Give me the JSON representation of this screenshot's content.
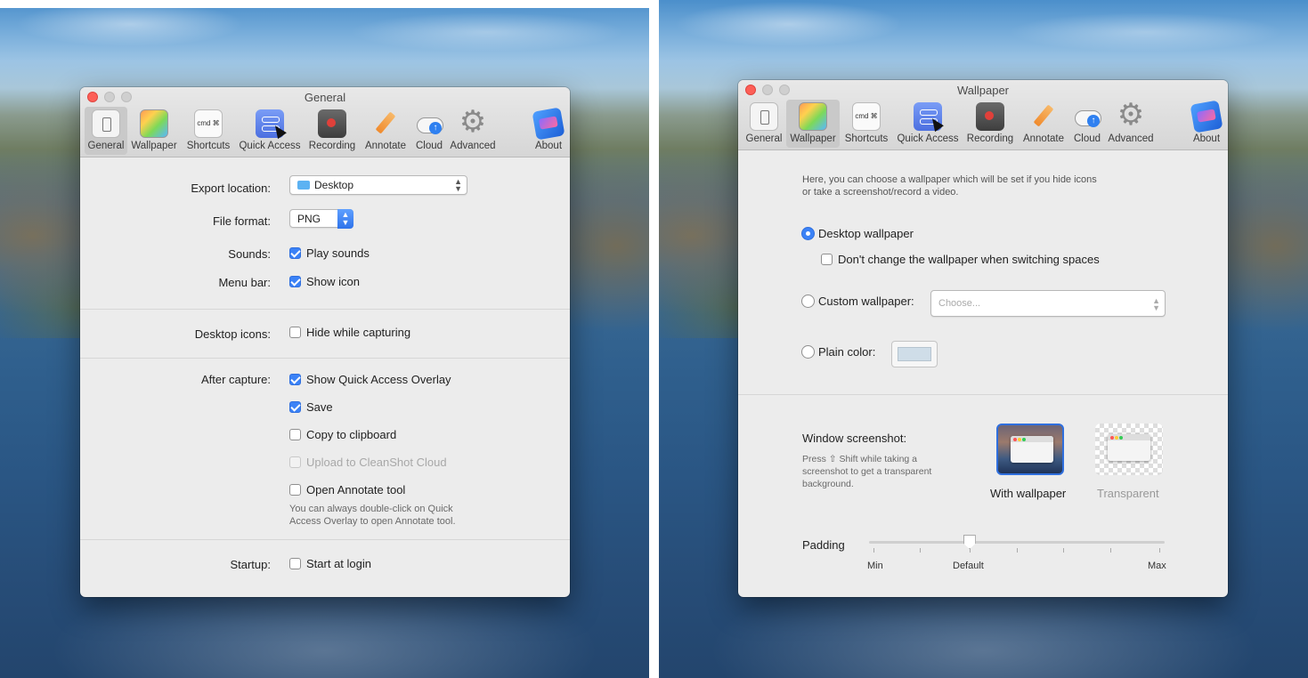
{
  "toolbar_items": [
    {
      "label": "General",
      "icon": "general-icon"
    },
    {
      "label": "Wallpaper",
      "icon": "wallpaper-icon"
    },
    {
      "label": "Shortcuts",
      "icon": "shortcuts-icon",
      "glyph": "cmd ⌘"
    },
    {
      "label": "Quick Access",
      "icon": "quick-access-icon"
    },
    {
      "label": "Recording",
      "icon": "recording-icon"
    },
    {
      "label": "Annotate",
      "icon": "annotate-icon"
    },
    {
      "label": "Cloud",
      "icon": "cloud-icon"
    },
    {
      "label": "Advanced",
      "icon": "advanced-icon"
    },
    {
      "label": "About",
      "icon": "about-icon"
    }
  ],
  "general": {
    "title": "General",
    "export_location_label": "Export location:",
    "export_location_value": "Desktop",
    "file_format_label": "File format:",
    "file_format_value": "PNG",
    "sounds_label": "Sounds:",
    "play_sounds": "Play sounds",
    "menu_bar_label": "Menu bar:",
    "show_icon": "Show icon",
    "desktop_icons_label": "Desktop icons:",
    "hide_while_capturing": "Hide while capturing",
    "after_capture_label": "After capture:",
    "show_quick_access_overlay": "Show Quick Access Overlay",
    "save": "Save",
    "copy_to_clipboard": "Copy to clipboard",
    "upload_to_cloud": "Upload to CleanShot Cloud",
    "open_annotate_tool": "Open Annotate tool",
    "annotate_hint_1": "You can always double-click on Quick",
    "annotate_hint_2": "Access Overlay to open Annotate tool.",
    "startup_label": "Startup:",
    "start_at_login": "Start at login"
  },
  "wallpaper": {
    "title": "Wallpaper",
    "intro_1": "Here, you can choose a wallpaper which will be set if you hide icons",
    "intro_2": "or take a screenshot/record a video.",
    "desktop_wallpaper": "Desktop wallpaper",
    "dont_change": "Don't change the wallpaper when switching spaces",
    "custom_wallpaper": "Custom wallpaper:",
    "choose_placeholder": "Choose...",
    "plain_color": "Plain color:",
    "plain_color_value": "#cfdde8",
    "window_screenshot_label": "Window screenshot:",
    "ws_hint_1": "Press ⇧ Shift while taking a",
    "ws_hint_2": "screenshot to get a transparent",
    "ws_hint_3": "background.",
    "with_wallpaper": "With wallpaper",
    "transparent": "Transparent",
    "padding_label": "Padding",
    "padding_min": "Min",
    "padding_default": "Default",
    "padding_max": "Max",
    "padding_level": 0.34
  }
}
